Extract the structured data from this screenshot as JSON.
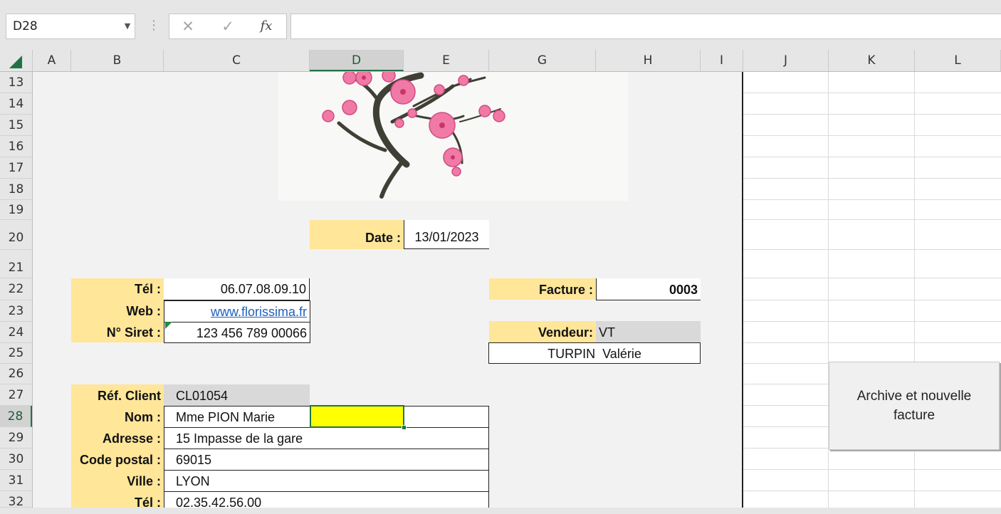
{
  "formula_bar": {
    "name_box": "D28",
    "cancel_icon": "✕",
    "confirm_icon": "✓",
    "fx_icon": "fx",
    "formula": ""
  },
  "columns": [
    "A",
    "B",
    "C",
    "D",
    "E",
    "G",
    "H",
    "I",
    "J",
    "K",
    "L"
  ],
  "selected_column": "D",
  "rows": [
    "13",
    "14",
    "15",
    "16",
    "17",
    "18",
    "19",
    "20",
    "21",
    "22",
    "23",
    "24",
    "25",
    "26",
    "27",
    "28",
    "29",
    "30",
    "31",
    "32"
  ],
  "selected_row": "28",
  "invoice": {
    "date_label": "Date :",
    "date_value": "13/01/2023",
    "tel_label": "Tél :",
    "tel_value": "06.07.08.09.10",
    "web_label": "Web :",
    "web_value": "www.florissima.fr",
    "siret_label": "N° Siret :",
    "siret_value": "123 456 789 00066",
    "facture_label": "Facture :",
    "facture_value": "0003",
    "vendeur_label": "Vendeur:",
    "vendeur_code": "VT",
    "vendeur_name": "TURPIN  Valérie",
    "ref_client_label": "Réf. Client",
    "ref_client_value": "CL01054",
    "nom_label": "Nom :",
    "nom_value": "Mme PION Marie",
    "adresse_label": "Adresse :",
    "adresse_value": "15 Impasse de la gare",
    "code_postal_label": "Code postal :",
    "code_postal_value": "69015",
    "ville_label": "Ville :",
    "ville_value": "LYON",
    "tel_client_label": "Tél :",
    "tel_client_value": "02.35.42.56.00"
  },
  "archive_button": "Archive et nouvelle facture",
  "colors": {
    "label_bg": "#ffe699",
    "selected_fill": "#ffff00",
    "excel_green": "#217346"
  }
}
